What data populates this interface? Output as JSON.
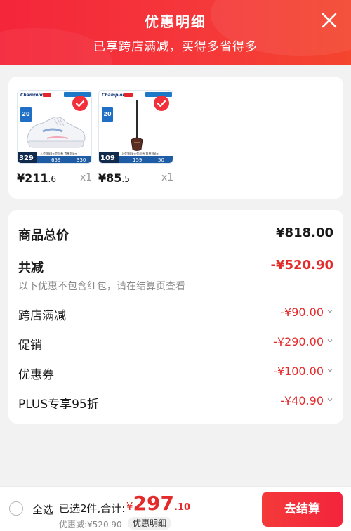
{
  "header": {
    "title": "优惠明细",
    "subtitle": "已享跨店满减，买得多省得多",
    "close_icon": "close-icon"
  },
  "products": [
    {
      "thumb": {
        "brand": "Champion",
        "badge": "20",
        "price_tag": "329",
        "num1": "659",
        "num2": "330",
        "caption": "入会领88元会员券 首单领8元"
      },
      "price_int": "¥211",
      "price_dec": ".6",
      "qty": "x1"
    },
    {
      "thumb": {
        "brand": "Champion",
        "badge": "20",
        "price_tag": "109",
        "num1": "159",
        "num2": "50",
        "caption": "入会领88元会员券 首单领8元"
      },
      "price_int": "¥85",
      "price_dec": ".5",
      "qty": "x1"
    }
  ],
  "summary": {
    "total_label": "商品总价",
    "total_value": "¥818.00",
    "reduce_label": "共减",
    "reduce_value": "-¥520.90",
    "hint": "以下优惠不包含红包，请在结算页查看",
    "items": [
      {
        "label": "跨店满减",
        "value": "-¥90.00"
      },
      {
        "label": "促销",
        "value": "-¥290.00"
      },
      {
        "label": "优惠券",
        "value": "-¥100.00"
      },
      {
        "label": "PLUS专享95折",
        "value": "-¥40.90"
      }
    ]
  },
  "bottom": {
    "select_all": "全选",
    "selected_info": "已选2件,合计:",
    "currency": "¥",
    "total_int": "297",
    "total_dec": ".10",
    "discount_line": "优惠减:¥520.90",
    "detail_button": "优惠明细",
    "checkout_button": "去结算"
  },
  "colors": {
    "brand_red": "#f4263a",
    "price_red": "#e42b2b",
    "check_red": "#f2303b"
  }
}
